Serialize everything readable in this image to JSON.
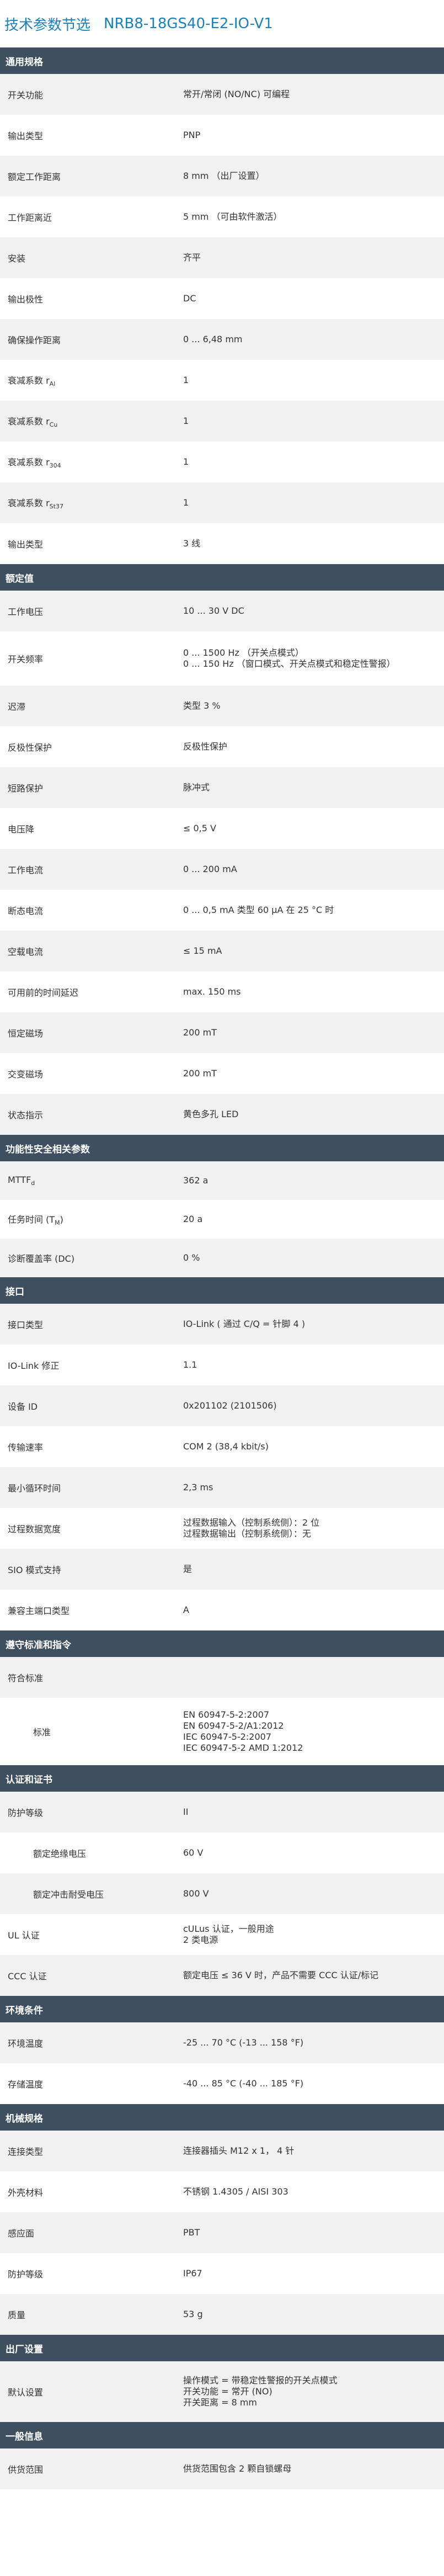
{
  "title": {
    "prefix": "技术参数节选",
    "model": "NRB8-18GS40-E2-IO-V1"
  },
  "sections": [
    {
      "id": "general",
      "heading": "通用规格",
      "rows": [
        {
          "label": "开关功能",
          "values": [
            "常开/常闭 (NO/NC) 可编程"
          ]
        },
        {
          "label": "输出类型",
          "values": [
            "PNP"
          ]
        },
        {
          "label": "额定工作距离",
          "values": [
            "8 mm （出厂设置）"
          ]
        },
        {
          "label": "工作距离近",
          "values": [
            "5 mm （可由软件激活）"
          ]
        },
        {
          "label": "安装",
          "values": [
            "齐平"
          ]
        },
        {
          "label": "输出极性",
          "values": [
            "DC"
          ]
        },
        {
          "label": "确保操作距离",
          "values": [
            "0 ... 6,48 mm"
          ]
        },
        {
          "label": "衰减系数 r",
          "sub": "Al",
          "values": [
            "1"
          ]
        },
        {
          "label": "衰减系数 r",
          "sub": "Cu",
          "values": [
            "1"
          ]
        },
        {
          "label": "衰减系数 r",
          "sub": "304",
          "values": [
            "1"
          ]
        },
        {
          "label": "衰减系数 r",
          "sub": "St37",
          "values": [
            "1"
          ]
        },
        {
          "label": "输出类型",
          "values": [
            "3 线"
          ]
        }
      ]
    },
    {
      "id": "ratings",
      "heading": "额定值",
      "rows": [
        {
          "label": "工作电压",
          "values": [
            "10 ... 30 V DC"
          ]
        },
        {
          "label": "开关频率",
          "values": [
            "0 ... 1500 Hz （开关点模式）",
            "0 ... 150 Hz （窗口模式、开关点模式和稳定性警报）"
          ]
        },
        {
          "label": "迟滞",
          "values": [
            "类型 3 %"
          ]
        },
        {
          "label": "反极性保护",
          "values": [
            "反极性保护"
          ]
        },
        {
          "label": "短路保护",
          "values": [
            "脉冲式"
          ]
        },
        {
          "label": "电压降",
          "values": [
            "≤ 0,5 V"
          ]
        },
        {
          "label": "工作电流",
          "values": [
            "0 ... 200 mA"
          ]
        },
        {
          "label": "断态电流",
          "values": [
            "0 ... 0,5 mA 类型 60 µA 在 25 °C 时"
          ]
        },
        {
          "label": "空载电流",
          "values": [
            "≤ 15 mA"
          ]
        },
        {
          "label": "可用前的时间延迟",
          "values": [
            "max. 150 ms"
          ]
        },
        {
          "label": "恒定磁场",
          "values": [
            "200 mT"
          ]
        },
        {
          "label": "交变磁场",
          "values": [
            "200 mT"
          ]
        },
        {
          "label": "状态指示",
          "values": [
            "黄色多孔 LED"
          ]
        }
      ]
    },
    {
      "id": "safety",
      "heading": "功能性安全相关参数",
      "rows": [
        {
          "label": "MTTF",
          "sub": "d",
          "values": [
            "362 a"
          ]
        },
        {
          "label": "任务时间 (T",
          "sub": "M",
          "suffix": ")",
          "values": [
            "20 a"
          ]
        },
        {
          "label": "诊断覆盖率 (DC)",
          "values": [
            "0 %"
          ]
        }
      ]
    },
    {
      "id": "interface",
      "heading": "接口",
      "rows": [
        {
          "label": "接口类型",
          "values": [
            "IO-Link ( 通过 C/Q = 针脚 4 )"
          ]
        },
        {
          "label": "IO-Link 修正",
          "values": [
            "1.1"
          ]
        },
        {
          "label": "设备 ID",
          "values": [
            "0x201102 (2101506)"
          ]
        },
        {
          "label": "传输速率",
          "values": [
            "COM 2 (38,4 kbit/s)"
          ]
        },
        {
          "label": "最小循环时间",
          "values": [
            "2,3 ms"
          ]
        },
        {
          "label": "过程数据宽度",
          "values": [
            "过程数据输入（控制系统侧）：2 位",
            "过程数据输出（控制系统侧）：无"
          ]
        },
        {
          "label": "SIO 模式支持",
          "values": [
            "是"
          ]
        },
        {
          "label": "兼容主端口类型",
          "values": [
            "A"
          ]
        }
      ]
    },
    {
      "id": "compliance",
      "heading": "遵守标准和指令",
      "rows": [
        {
          "label": "符合标准",
          "values": []
        },
        {
          "label": "标准",
          "indent": true,
          "values": [
            "EN 60947-5-2:2007",
            "EN 60947-5-2/A1:2012",
            "IEC 60947-5-2:2007",
            "IEC 60947-5-2 AMD 1:2012"
          ]
        }
      ]
    },
    {
      "id": "approvals",
      "heading": "认证和证书",
      "rows": [
        {
          "label": "防护等级",
          "values": [
            "II"
          ]
        },
        {
          "label": "额定绝缘电压",
          "indent": true,
          "values": [
            "60 V"
          ]
        },
        {
          "label": "额定冲击耐受电压",
          "indent": true,
          "values": [
            "800 V"
          ]
        },
        {
          "label": "UL 认证",
          "values": [
            "cULus 认证，一般用途",
            "2 类电源"
          ]
        },
        {
          "label": "CCC 认证",
          "values": [
            "额定电压 ≤ 36 V 时，产品不需要 CCC 认证/标记"
          ]
        }
      ]
    },
    {
      "id": "ambient",
      "heading": "环境条件",
      "rows": [
        {
          "label": "环境温度",
          "values": [
            "-25 ... 70 °C (-13 ... 158 °F)"
          ]
        },
        {
          "label": "存储温度",
          "values": [
            "-40 ... 85 °C (-40 ... 185 °F)"
          ]
        }
      ]
    },
    {
      "id": "mechanical",
      "heading": "机械规格",
      "rows": [
        {
          "label": "连接类型",
          "values": [
            "连接器插头 M12 x 1， 4 针"
          ]
        },
        {
          "label": "外壳材料",
          "values": [
            "不锈钢 1.4305 / AISI 303"
          ]
        },
        {
          "label": "感应面",
          "values": [
            "PBT"
          ]
        },
        {
          "label": "防护等级",
          "values": [
            "IP67"
          ]
        },
        {
          "label": "质量",
          "values": [
            "53 g"
          ]
        }
      ]
    },
    {
      "id": "factory",
      "heading": "出厂设置",
      "rows": [
        {
          "label": "默认设置",
          "values": [
            "操作模式 = 带稳定性警报的开关点模式",
            "开关功能 = 常开 (NO)",
            "开关距离 = 8 mm"
          ]
        }
      ]
    },
    {
      "id": "info",
      "heading": "一般信息",
      "rows": [
        {
          "label": "供货范围",
          "values": [
            "供货范围包含 2 颗自锁螺母"
          ]
        }
      ]
    }
  ]
}
